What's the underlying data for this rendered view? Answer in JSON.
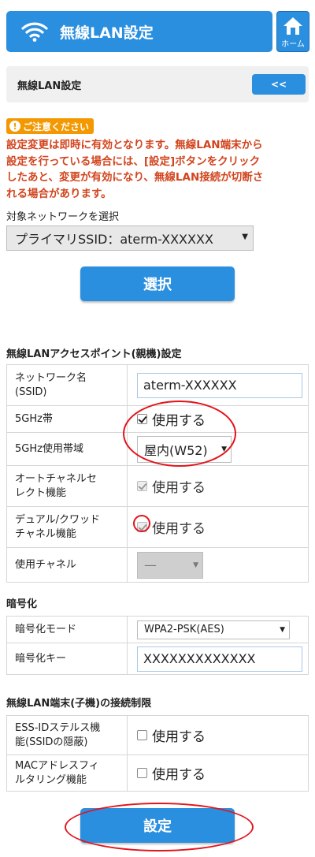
{
  "header": {
    "title": "無線LAN設定",
    "home_label": "ホーム",
    "icon": "wifi-icon"
  },
  "subbar": {
    "label": "無線LAN設定",
    "back_label": "<<"
  },
  "caution": {
    "badge": "ご注意ください",
    "lines": [
      "設定変更は即時に有効となります。無線LAN端末から",
      "設定を行っている場合には、[設定]ボタンをクリック",
      "したあと、変更が有効になり、無線LAN接続が切断さ",
      "れる場合があります。"
    ]
  },
  "network": {
    "label": "対象ネットワークを選択",
    "selected": "プライマリSSID：aterm-XXXXXX",
    "select_button": "選択"
  },
  "ap_section": {
    "title": "無線LANアクセスポイント(親機)設定",
    "rows": {
      "ssid": {
        "label_l1": "ネットワーク名",
        "label_l2": "(SSID)",
        "value": "aterm-XXXXXX"
      },
      "band5": {
        "label": "5GHz帯",
        "checkbox_label": "使用する",
        "checked": true
      },
      "band5_range": {
        "label": "5GHz使用帯域",
        "selected": "屋内(W52)"
      },
      "auto_channel": {
        "label_l1": "オートチャネルセ",
        "label_l2": "レクト機能",
        "checkbox_label": "使用する",
        "checked": true,
        "disabled": true
      },
      "dual_quad": {
        "label_l1": "デュアル/クワッド",
        "label_l2": "チャネル機能",
        "checkbox_label": "使用する",
        "checked": true,
        "disabled": true
      },
      "channel": {
        "label": "使用チャネル",
        "selected": "—"
      }
    }
  },
  "encryption": {
    "title": "暗号化",
    "mode_label": "暗号化モード",
    "mode_value": "WPA2-PSK(AES)",
    "key_label": "暗号化キー",
    "key_value": "XXXXXXXXXXXXX"
  },
  "restriction": {
    "title": "無線LAN端末(子機)の接続制限",
    "essid_stealth": {
      "label_l1": "ESS-IDステルス機",
      "label_l2": "能(SSIDの隠蔽)",
      "checkbox_label": "使用する",
      "checked": false
    },
    "mac_filter": {
      "label_l1": "MACアドレスフィ",
      "label_l2": "ルタリング機能",
      "checkbox_label": "使用する",
      "checked": false
    }
  },
  "submit": {
    "label": "設定"
  },
  "colors": {
    "primary": "#2b8fe0",
    "warning": "#d2451e",
    "badge": "#f39800",
    "highlight": "#e3141c"
  }
}
